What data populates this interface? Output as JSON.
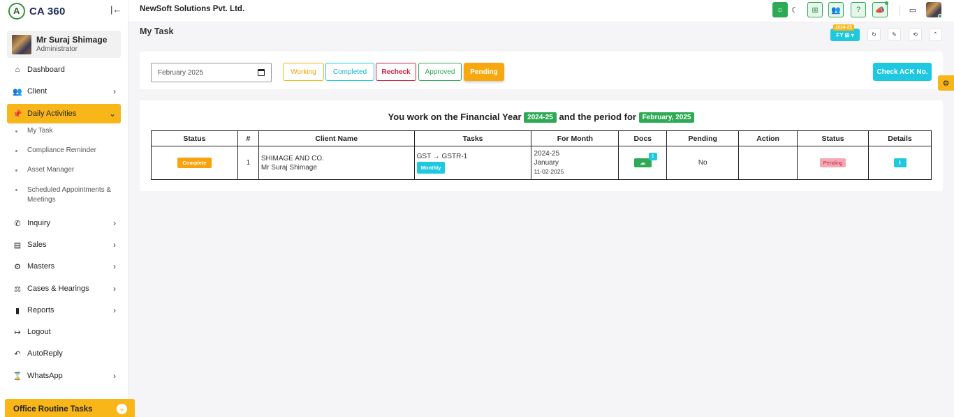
{
  "app": {
    "logo_text": "CA 360",
    "collapse_icon": "collapse-left-icon"
  },
  "user": {
    "name": "Mr Suraj Shimage",
    "role": "Administrator"
  },
  "sidebar": {
    "items": [
      {
        "label": "Dashboard",
        "icon": "home-icon"
      },
      {
        "label": "Client",
        "icon": "users-icon"
      },
      {
        "label": "Daily Activities",
        "icon": "pin-icon"
      },
      {
        "label": "Inquiry",
        "icon": "phone-icon"
      },
      {
        "label": "Sales",
        "icon": "money-icon"
      },
      {
        "label": "Masters",
        "icon": "cogs-icon"
      },
      {
        "label": "Cases & Hearings",
        "icon": "scale-icon"
      },
      {
        "label": "Reports",
        "icon": "file-icon"
      },
      {
        "label": "Logout",
        "icon": "logout-icon"
      },
      {
        "label": "AutoReply",
        "icon": "reply-icon"
      },
      {
        "label": "WhatsApp",
        "icon": "whatsapp-icon"
      }
    ],
    "submenu": [
      "My Task",
      "Compliance Reminder",
      "Asset Manager",
      "Scheduled Appointments & Meetings"
    ],
    "office_routine": "Office Routine Tasks"
  },
  "topbar": {
    "company": "NewSoft Solutions Pvt. Ltd."
  },
  "page": {
    "title": "My Task",
    "fy_year": "2024-25",
    "fy_label": "FY ⊞ ▾"
  },
  "filters": {
    "month": "February 2025",
    "working": "Working",
    "completed": "Completed",
    "recheck": "Recheck",
    "approved": "Approved",
    "pending": "Pending",
    "check_ack": "Check ACK No."
  },
  "summary": {
    "prefix": "You work on the Financial Year",
    "year": "2024-25",
    "middle": "and the period for",
    "period": "February, 2025"
  },
  "table": {
    "headers": [
      "Status",
      "#",
      "Client Name",
      "Tasks",
      "For Month",
      "Docs",
      "Pending",
      "Action",
      "Status",
      "Details"
    ],
    "rows": [
      {
        "status": "Complete",
        "num": "1",
        "client_line1": "SHIMAGE AND CO.",
        "client_line2": "Mr Suraj Shimage",
        "task": "GST → GSTR-1",
        "frequency": "Monthly",
        "month_fy": "2024-25",
        "month_name": "January",
        "month_date": "11-02-2025",
        "docs_count": "1",
        "pending": "No",
        "status2": "Pending",
        "details": "i"
      }
    ]
  },
  "colors": {
    "accent": "#f8b619",
    "cyan": "#1ec8e0",
    "green": "#2eaa55",
    "red": "#d0223f"
  }
}
